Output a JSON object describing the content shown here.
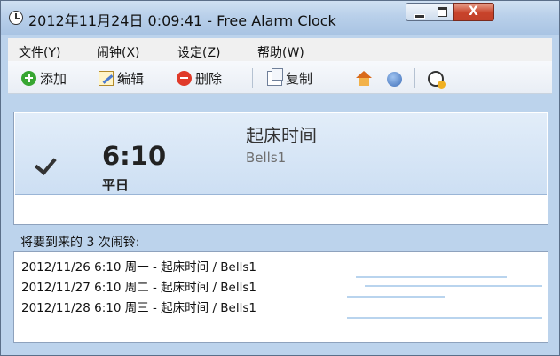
{
  "window": {
    "title": "2012年11月24日 0:09:41 - Free Alarm Clock",
    "controls": {
      "minimize": "minimize",
      "maximize": "maximize",
      "close": "X"
    }
  },
  "menu": {
    "items": [
      "文件(Y)",
      "闹钟(X)",
      "设定(Z)",
      "帮助(W)"
    ]
  },
  "toolbar": {
    "add_label": "添加",
    "edit_label": "编辑",
    "delete_label": "删除",
    "copy_label": "复制",
    "icons": [
      "add-icon",
      "edit-icon",
      "delete-icon",
      "copy-icon",
      "home-icon",
      "help-icon",
      "clock-settings-icon"
    ]
  },
  "alarms": [
    {
      "enabled": true,
      "time": "6:10",
      "repeat": "平日",
      "label": "起床时间",
      "sound": "Bells1"
    }
  ],
  "upcoming": {
    "title": "将要到来的 3 次闹铃:",
    "items": [
      "2012/11/26 6:10 周一 - 起床时间 / Bells1",
      "2012/11/27 6:10 周二 - 起床时间 / Bells1",
      "2012/11/28 6:10 周三 - 起床时间 / Bells1"
    ]
  },
  "colors": {
    "selected_row": "#cddff3",
    "title_bar": "#b9d0ea",
    "close_button": "#c8432a"
  }
}
